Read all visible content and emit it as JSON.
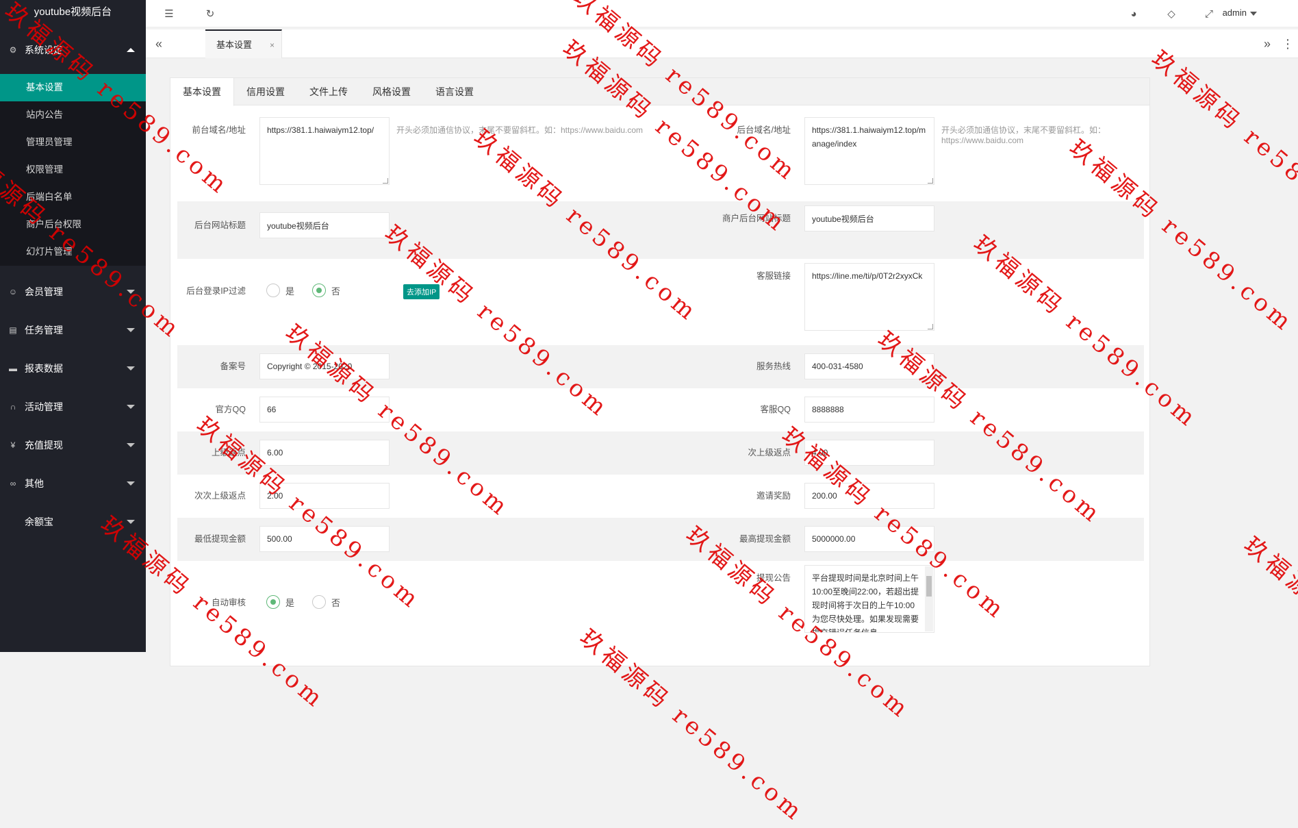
{
  "app": {
    "title": "youtube视频后台"
  },
  "sidebar": {
    "group_system": "系统设定",
    "sub_items": [
      "基本设置",
      "站内公告",
      "管理员管理",
      "权限管理",
      "后端白名单",
      "商户后台权限",
      "幻灯片管理"
    ],
    "groups": [
      "会员管理",
      "任务管理",
      "报表数据",
      "活动管理",
      "充值提现",
      "其他",
      "余额宝"
    ]
  },
  "header": {
    "user": "admin"
  },
  "tabbar": {
    "open_tab": "基本设置",
    "close": "×"
  },
  "subtabs": [
    "基本设置",
    "信用设置",
    "文件上传",
    "风格设置",
    "语言设置"
  ],
  "form": {
    "frontend_domain_label": "前台域名/地址",
    "frontend_domain_value": "https://381.1.haiwaiym12.top/",
    "frontend_domain_hint": "开头必须加通信协议，末尾不要留斜杠。如：https://www.baidu.com",
    "backend_domain_label": "后台域名/地址",
    "backend_domain_value": "https://381.1.haiwaiym12.top/manage/index",
    "backend_domain_hint": "开头必须加通信协议，末尾不要留斜杠。如：https://www.baidu.com",
    "site_title_label": "后台网站标题",
    "site_title_value": "youtube视频后台",
    "merchant_title_label": "商户后台网站标题",
    "merchant_title_value": "youtube视频后台",
    "ip_filter_label": "后台登录IP过滤",
    "yes": "是",
    "no": "否",
    "add_ip_button": "去添加IP",
    "service_link_label": "客服链接",
    "service_link_value": "https://line.me/ti/p/0T2r2xyxCk",
    "icp_label": "备案号",
    "icp_value": "Copyright © 2015-2020",
    "hotline_label": "服务热线",
    "hotline_value": "400-031-4580",
    "official_qq_label": "官方QQ",
    "official_qq_value": "66",
    "service_qq_label": "客服QQ",
    "service_qq_value": "8888888",
    "upper_rebate_label": "上级返点",
    "upper_rebate_value": "6.00",
    "second_rebate_label": "次上级返点",
    "second_rebate_value": "4.00",
    "third_rebate_label": "次次上级返点",
    "third_rebate_value": "2.00",
    "invite_reward_label": "邀请奖励",
    "invite_reward_value": "200.00",
    "min_withdraw_label": "最低提现金额",
    "min_withdraw_value": "500.00",
    "max_withdraw_label": "最高提现金额",
    "max_withdraw_value": "5000000.00",
    "auto_review_label": "自动审核",
    "withdraw_notice_label": "提现公告",
    "withdraw_notice_value": "平台提现时间是北京时间上午10:00至晚间22:00，若超出提现时间将于次日的上午10:00为您尽快处理。如果发现需要提交错误任务信息"
  },
  "watermark": {
    "text": "玖福源码 re589.com"
  },
  "colors": {
    "accent": "#009688",
    "sidebar": "#20222a",
    "radio_on": "#5fb878",
    "watermark": "#e10000"
  }
}
